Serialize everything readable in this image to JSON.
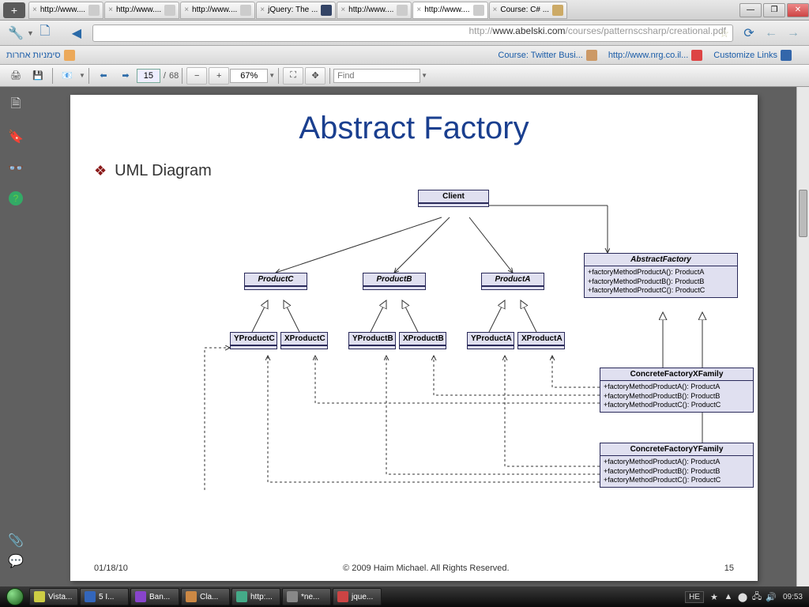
{
  "window": {
    "tabs": [
      {
        "label": "http://www....",
        "active": false
      },
      {
        "label": "http://www....",
        "active": false
      },
      {
        "label": "http://www....",
        "active": false
      },
      {
        "label": "jQuery: The ...",
        "active": false
      },
      {
        "label": "http://www....",
        "active": false
      },
      {
        "label": "http://www....",
        "active": true
      },
      {
        "label": "Course: C# ...",
        "active": false
      }
    ]
  },
  "url": {
    "gray_prefix": "http://",
    "host": "www.abelski.com",
    "path": "/courses/patternscsharp/creational.pdf"
  },
  "bookmarks": {
    "other": "סימניות אחרות",
    "right": [
      {
        "label": "Course: Twitter Busi..."
      },
      {
        "label": "http://www.nrg.co.il..."
      },
      {
        "label": "Customize Links"
      }
    ]
  },
  "pdf_toolbar": {
    "page_current": "15",
    "page_sep": "/",
    "page_total": "68",
    "zoom": "67%",
    "find_placeholder": "Find"
  },
  "slide": {
    "title": "Abstract Factory",
    "bullet": "UML Diagram",
    "boxes": {
      "client": "Client",
      "productC": "ProductC",
      "productB": "ProductB",
      "productA": "ProductA",
      "yProductC": "YProductC",
      "xProductC": "XProductC",
      "yProductB": "YProductB",
      "xProductB": "XProductB",
      "yProductA": "YProductA",
      "xProductA": "XProductA",
      "abstractFactory": "AbstractFactory",
      "abstractFactory_m1": "+factoryMethodProductA(): ProductA",
      "abstractFactory_m2": "+factoryMethodProductB(): ProductB",
      "abstractFactory_m3": "+factoryMethodProductC(): ProductC",
      "concreteX": "ConcreteFactoryXFamily",
      "concreteX_m1": "+factoryMethodProductA(): ProductA",
      "concreteX_m2": "+factoryMethodProductB(): ProductB",
      "concreteX_m3": "+factoryMethodProductC(): ProductC",
      "concreteY": "ConcreteFactoryYFamily",
      "concreteY_m1": "+factoryMethodProductA(): ProductA",
      "concreteY_m2": "+factoryMethodProductB(): ProductB",
      "concreteY_m3": "+factoryMethodProductC(): ProductC"
    },
    "footer_date": "01/18/10",
    "footer_copyright": "© 2009 Haim Michael. All Rights Reserved.",
    "footer_page": "15"
  },
  "taskbar": {
    "items": [
      {
        "label": "Vista..."
      },
      {
        "label": "5 I..."
      },
      {
        "label": "Ban..."
      },
      {
        "label": "Cla..."
      },
      {
        "label": "http:..."
      },
      {
        "label": "*ne..."
      },
      {
        "label": "jque..."
      }
    ],
    "lang": "HE",
    "clock": "09:53"
  }
}
